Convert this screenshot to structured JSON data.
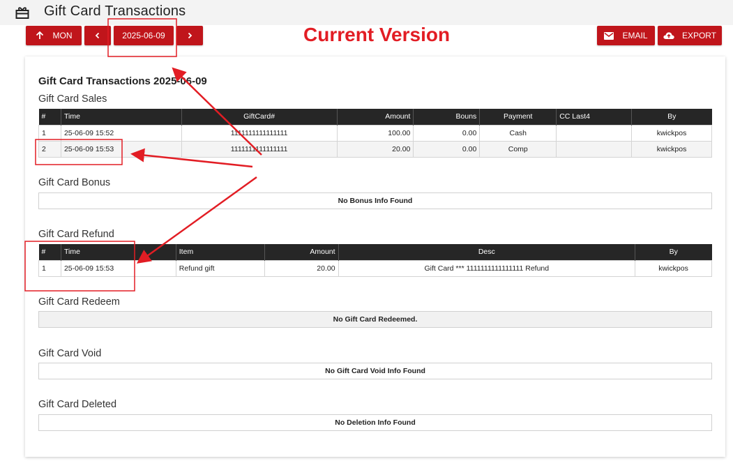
{
  "header": {
    "title": "Gift Card Transactions",
    "icon": "gift-icon"
  },
  "toolbar": {
    "mon_label": "MON",
    "mon_icon": "arrow-up-icon",
    "prev_icon": "chevron-left-icon",
    "date_value": "2025-06-09",
    "next_icon": "chevron-right-icon",
    "email_label": "EMAIL",
    "email_icon": "mail-icon",
    "export_label": "EXPORT",
    "export_icon": "cloud-upload-icon"
  },
  "annotation": {
    "version_label": "Current Version",
    "color": "#e21d24"
  },
  "colors": {
    "accent": "#c0151b",
    "table_header": "#262626"
  },
  "report": {
    "title": "Gift Card Transactions 2025-06-09",
    "sales": {
      "title": "Gift Card Sales",
      "columns": [
        "#",
        "Time",
        "GiftCard#",
        "Amount",
        "Bouns",
        "Payment",
        "CC Last4",
        "By"
      ],
      "rows": [
        [
          "1",
          "25-06-09 15:52",
          "1111111111111111",
          "100.00",
          "0.00",
          "Cash",
          "",
          "kwickpos"
        ],
        [
          "2",
          "25-06-09 15:53",
          "1111111111111111",
          "20.00",
          "0.00",
          "Comp",
          "",
          "kwickpos"
        ]
      ]
    },
    "bonus": {
      "title": "Gift Card Bonus",
      "empty": "No Bonus Info Found"
    },
    "refund": {
      "title": "Gift Card Refund",
      "columns": [
        "#",
        "Time",
        "Item",
        "Amount",
        "Desc",
        "By"
      ],
      "rows": [
        [
          "1",
          "25-06-09 15:53",
          "Refund gift",
          "20.00",
          "Gift Card *** 1111111111111111 Refund",
          "kwickpos"
        ]
      ]
    },
    "redeem": {
      "title": "Gift Card Redeem",
      "empty": "No Gift Card Redeemed."
    },
    "void": {
      "title": "Gift Card Void",
      "empty": "No Gift Card Void Info Found"
    },
    "deleted": {
      "title": "Gift Card Deleted",
      "empty": "No Deletion Info Found"
    }
  }
}
